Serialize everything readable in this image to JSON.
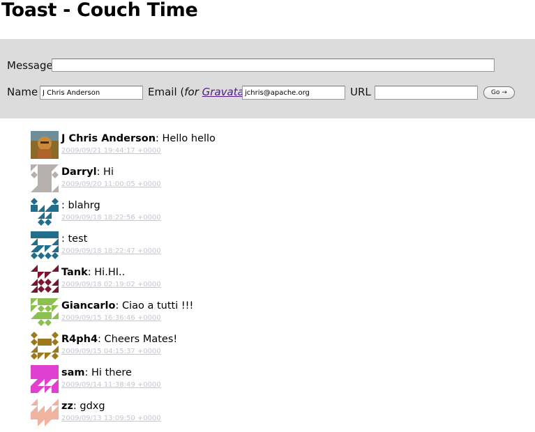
{
  "page": {
    "title": "Toast - Couch Time"
  },
  "form": {
    "message_label": "Message",
    "message_value": "",
    "name_label": "Name",
    "name_value": "J Chris Anderson",
    "email_label": "Email (",
    "email_for": "for ",
    "email_link": "Gravatar",
    "email_close": ")",
    "email_value": "jchris@apache.org",
    "url_label": "URL",
    "url_value": "",
    "go_label": "Go →"
  },
  "messages": [
    {
      "author": "J Chris Anderson",
      "text": ": Hello hello",
      "time": "2009/09/21 19:44:17 +0000",
      "avatar": "photo"
    },
    {
      "author": "Darryl",
      "text": ": Hi",
      "time": "2009/09/20 11:00:05 +0000",
      "avatar": "identicon-gray"
    },
    {
      "author": "",
      "text": ": blahrg",
      "time": "2009/09/18 18:22:56 +0000",
      "avatar": "identicon-teal"
    },
    {
      "author": "",
      "text": ": test",
      "time": "2009/09/18 18:22:47 +0000",
      "avatar": "identicon-teal"
    },
    {
      "author": "Tank",
      "text": ": Hi.HI..",
      "time": "2009/09/18 02:19:02 +0000",
      "avatar": "identicon-maroon"
    },
    {
      "author": "Giancarlo",
      "text": ": Ciao a tutti !!!",
      "time": "2009/09/15 16:36:46 +0000",
      "avatar": "identicon-green"
    },
    {
      "author": "R4ph4",
      "text": ": Cheers Mates!",
      "time": "2009/09/15 04:15:37 +0000",
      "avatar": "identicon-olive"
    },
    {
      "author": "sam",
      "text": ": Hi there",
      "time": "2009/09/14 11:38:49 +0000",
      "avatar": "identicon-magenta"
    },
    {
      "author": "zz",
      "text": ": gdxg",
      "time": "2009/09/13 13:09:50 +0000",
      "avatar": "identicon-peach"
    }
  ],
  "colors": {
    "panel": "#dcdcdc",
    "link": "#551a8b",
    "timestamp": "#c6c6cc",
    "identicon-gray": "#b5b0ae",
    "identicon-teal": "#1f6f8c",
    "identicon-maroon": "#7a1530",
    "identicon-green": "#8cc152",
    "identicon-olive": "#9a7a1c",
    "identicon-magenta": "#e040d0",
    "identicon-peach": "#efb3a0"
  }
}
